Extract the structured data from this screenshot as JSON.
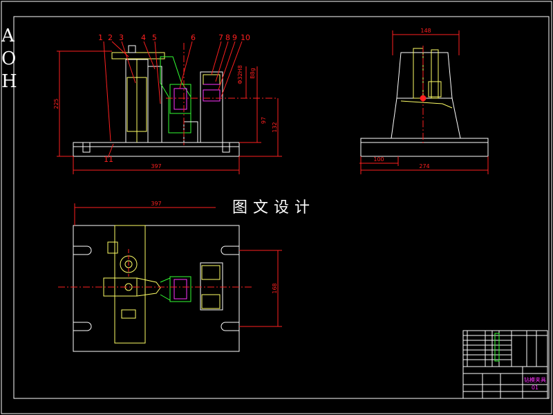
{
  "sheet": {
    "side_stamp": [
      "A",
      "O",
      "H"
    ],
    "watermark": "图文设计"
  },
  "part_numbers": [
    "1",
    "2",
    "3",
    "4",
    "5",
    "6",
    "7",
    "8",
    "9",
    "10",
    "11"
  ],
  "dimensions": {
    "front_height": "225",
    "front_width": "397",
    "center_height": "132",
    "sub_height": "97",
    "bore_dia": "Φ32H8",
    "bore_fit": "B8g",
    "side_top_width": "148",
    "side_offset": "100",
    "side_width": "274",
    "plan_width": "397",
    "plan_height": "168"
  },
  "title_block": {
    "drawing_title": "钻模夹具",
    "sheet_no": "01"
  },
  "colors": {
    "outline": "#ffffff",
    "dimension": "#ff2020",
    "center": "#ff2020",
    "part": "#ffff66",
    "highlight": "#33ff33",
    "frame": "#ffffff",
    "title": "#ff33ff",
    "hatch": "#ff33ff"
  }
}
